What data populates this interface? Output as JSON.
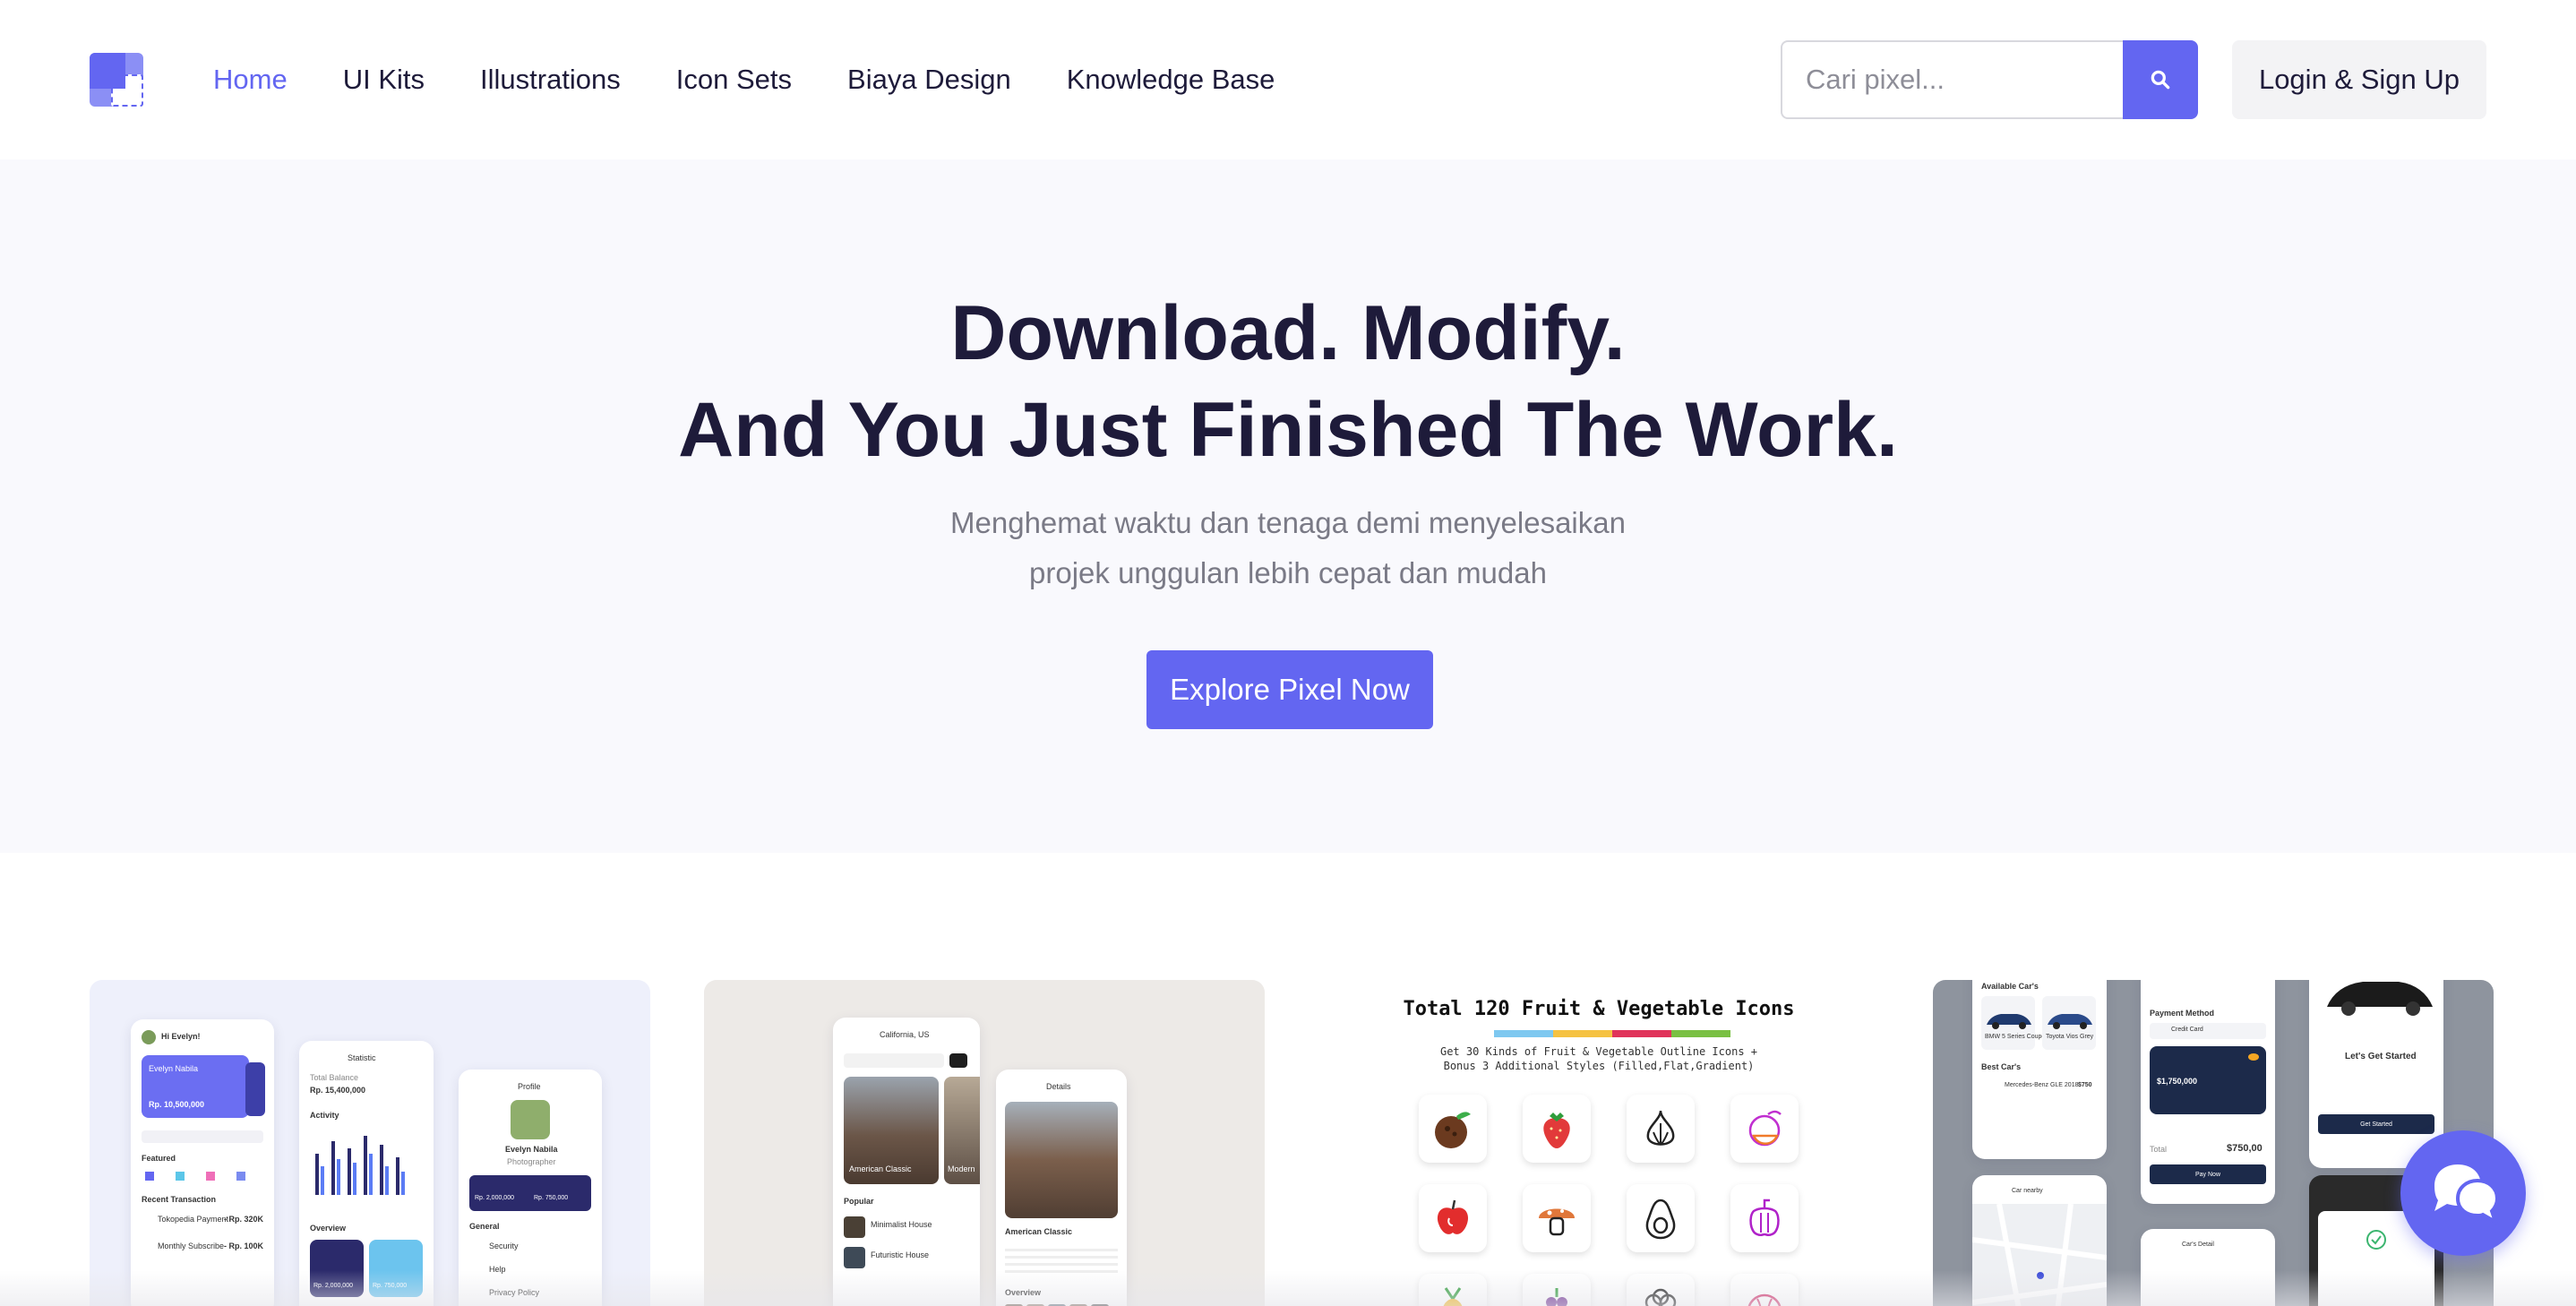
{
  "brand": {
    "accent": "#6366f1",
    "logo_icon": "pixel-logo-icon"
  },
  "nav": {
    "items": [
      {
        "label": "Home",
        "active": true
      },
      {
        "label": "UI Kits",
        "active": false
      },
      {
        "label": "Illustrations",
        "active": false
      },
      {
        "label": "Icon Sets",
        "active": false
      },
      {
        "label": "Biaya Design",
        "active": false
      },
      {
        "label": "Knowledge Base",
        "active": false
      }
    ],
    "search_placeholder": "Cari pixel...",
    "search_icon": "search-icon",
    "login_label": "Login & Sign Up"
  },
  "hero": {
    "title_line1": "Download. Modify.",
    "title_line2": "And You Just Finished The Work.",
    "subtitle_line1": "Menghemat waktu dan tenaga demi menyelesaikan",
    "subtitle_line2": "projek unggulan lebih cepat dan mudah",
    "cta_label": "Explore Pixel Now"
  },
  "cards": {
    "card1": {
      "greeting": "Hi Evelyn!",
      "statistic_title": "Statistic",
      "total_balance_label": "Total Balance",
      "total_balance": "Rp. 15,400,000",
      "activity_label": "Activity",
      "card_name": "Evelyn Nabila",
      "card_amount": "Rp. 10,500,000",
      "profile_title": "Profile",
      "profile_name": "Evelyn Nabila",
      "profile_role": "Photographer",
      "featured_label": "Featured",
      "recent_label": "Recent Transaction",
      "tx1": "Tokopedia Payment",
      "tx1_amount": "- Rp. 320K",
      "tx2": "Monthly Subscribe",
      "tx2_amount": "- Rp. 100K",
      "overview_label": "Overview",
      "general_label": "General",
      "menu_security": "Security",
      "menu_help": "Help",
      "menu_privacy": "Privacy Policy",
      "income": "Rp. 2,000,000",
      "expense": "Rp. 750,000"
    },
    "card2": {
      "location": "California, US",
      "listing1": "American Classic",
      "listing2": "Modern",
      "popular_label": "Popular",
      "pop1": "Minimalist House",
      "pop2": "Futuristic House",
      "detail_title": "Details",
      "detail_name": "American Classic",
      "overview_label": "Overview"
    },
    "card3": {
      "title": "Total 120 Fruit & Vegetable Icons",
      "subtitle_line1": "Get 30 Kinds of Fruit & Vegetable Outline Icons +",
      "subtitle_line2": "Bonus 3 Additional Styles (Filled,Flat,Gradient)",
      "stripe_colors": [
        "#7ec8f0",
        "#f5c242",
        "#e0335a",
        "#7ac043"
      ],
      "icons": [
        "coconut-icon",
        "strawberry-icon",
        "garlic-icon",
        "lemon-slice-icon",
        "apple-icon",
        "mushroom-icon",
        "avocado-icon",
        "bell-pepper-icon",
        "pineapple-icon",
        "grape-icon",
        "cauliflower-icon",
        "watermelon-icon"
      ]
    },
    "card4": {
      "available_label": "Available Car's",
      "car1": "BMW 5 Series Coupe",
      "car2": "Toyota Vios Grey",
      "best_label": "Best Car's",
      "best_car": "Mercedes-Benz GLE 2018",
      "best_price": "$750",
      "payment_label": "Payment Method",
      "card_type": "Credit Card",
      "pay_amount": "$1,750,000",
      "total_label": "Total",
      "total_amount": "$750,00",
      "pay_button": "Pay Now",
      "start_title": "Let's Get Started",
      "start_button": "Get Started",
      "nearby_label": "Car nearby",
      "details_label": "Car's Detail"
    }
  },
  "chat": {
    "icon": "chat-bubbles-icon"
  }
}
